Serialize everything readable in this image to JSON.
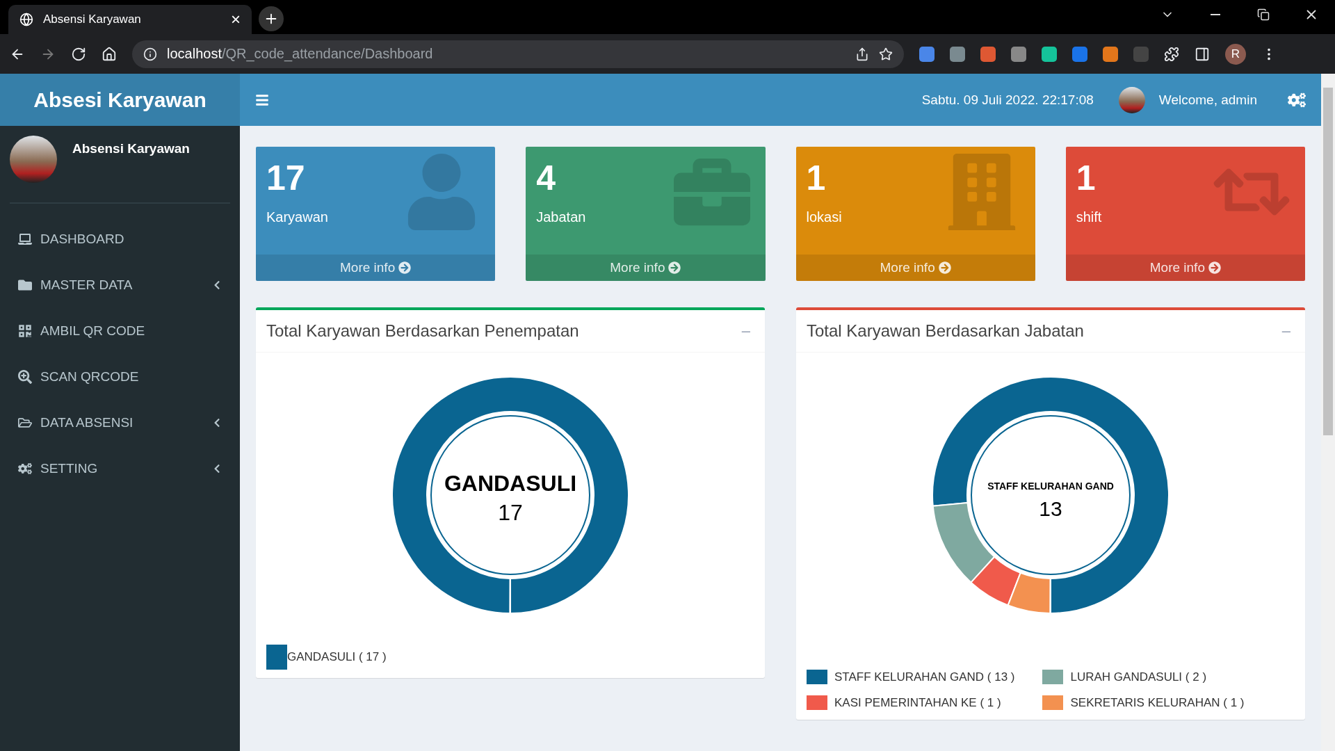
{
  "browser": {
    "tab_title": "Absensi Karyawan",
    "tab_close": "×",
    "url_host": "localhost",
    "url_path": "/QR_code_attendance/Dashboard",
    "profile_initial": "R"
  },
  "app": {
    "brand": "Absesi Karyawan",
    "user_panel_name": "Absensi Karyawan",
    "datetime": "Sabtu. 09 Juli 2022. 22:17:08",
    "welcome": "Welcome, admin"
  },
  "sidebar": {
    "items": [
      {
        "label": "DASHBOARD",
        "kind": "link"
      },
      {
        "label": "MASTER DATA",
        "kind": "tree"
      },
      {
        "label": "AMBIL QR CODE",
        "kind": "link"
      },
      {
        "label": "SCAN QRCODE",
        "kind": "link"
      },
      {
        "label": "DATA ABSENSI",
        "kind": "tree"
      },
      {
        "label": "SETTING",
        "kind": "tree"
      }
    ]
  },
  "stat_cards": [
    {
      "value": "17",
      "label": "Karyawan",
      "link": "More info",
      "color": "#3c8dbc"
    },
    {
      "value": "4",
      "label": "Jabatan",
      "link": "More info",
      "color": "#3d9970"
    },
    {
      "value": "1",
      "label": "lokasi",
      "link": "More info",
      "color": "#db8b0b"
    },
    {
      "value": "1",
      "label": "shift",
      "link": "More info",
      "color": "#dd4b39"
    }
  ],
  "panels": [
    {
      "title": "Total Karyawan Berdasarkan Penempatan",
      "collapse": "–",
      "center_label": "GANDASULI",
      "center_value": "17",
      "chart_data": {
        "type": "donut",
        "categories": [
          "GANDASULI"
        ],
        "values": [
          100
        ]
      },
      "legend": [
        {
          "count": "( 17 )",
          "color": "#0a6591"
        }
      ]
    },
    {
      "title": "Total Karyawan Berdasarkan Jabatan",
      "collapse": "–",
      "center_label": "STAFF KELURAHAN GAND",
      "center_value": "13",
      "chart_data": {
        "type": "donut",
        "categories": [
          "STAFF KELURAHAN GAND",
          "LURAH GANDASULI",
          "KASI PEMERINTAHAN KE",
          "SEKRETARIS KELURAHAN"
        ],
        "values": [
          76.47,
          11.77,
          5.88,
          5.88
        ]
      },
      "legend": [
        {
          "count": "( 13 )",
          "color": "#0a6591"
        },
        {
          "count": "( 2 )",
          "color": "#7fa9a0"
        },
        {
          "count": "( 1 )",
          "color": "#f05a4b"
        },
        {
          "count": "( 1 )",
          "color": "#f39150"
        }
      ]
    }
  ]
}
